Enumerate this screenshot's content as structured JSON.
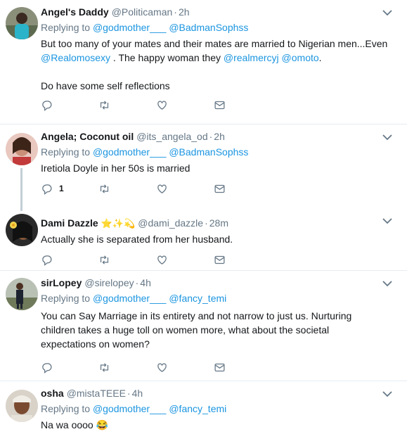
{
  "accent_color": "#1b95e0",
  "icons": {
    "reply": "reply-icon",
    "retweet": "retweet-icon",
    "like": "heart-icon",
    "dm": "mail-icon",
    "more": "chevron-down-icon"
  },
  "tweets": [
    {
      "name": "Angel's Daddy",
      "handle": "@Politicaman",
      "time": "2h",
      "reply_prefix": "Replying to",
      "reply_to": [
        "@godmother___",
        "@BadmanSophss"
      ],
      "text_line1": "But too many of your mates and their mates are married to Nigerian men...Even",
      "text_mention1": "@Realomosexy",
      "text_mid": ". The happy woman they",
      "text_mention2": "@realmercyj",
      "text_mention3": "@omoto",
      "text_end": ".",
      "text_line3": "Do have some self reflections"
    },
    {
      "name": "Angela; Coconut oil",
      "handle": "@its_angela_od",
      "time": "2h",
      "reply_prefix": "Replying to",
      "reply_to": [
        "@godmother___",
        "@BadmanSophss"
      ],
      "text": "Iretiola Doyle in her 50s is married",
      "reply_count": "1"
    },
    {
      "name": "Dami Dazzle",
      "name_emoji": "⭐✨💫",
      "handle": "@dami_dazzle",
      "time": "28m",
      "text": "Actually she is separated from her husband."
    },
    {
      "name": "sirLopey",
      "handle": "@sirelopey",
      "time": "4h",
      "reply_prefix": "Replying to",
      "reply_to": [
        "@godmother___",
        "@fancy_temi"
      ],
      "text": "You can Say Marriage in its entirety and not narrow to just us.  Nurturing children takes a huge toll on women more, what about the societal expectations on women?"
    },
    {
      "name": "osha",
      "handle": "@mistaTEEE",
      "time": "4h",
      "reply_prefix": "Replying to",
      "reply_to": [
        "@godmother___",
        "@fancy_temi"
      ],
      "text": "Na wa oooo",
      "text_emoji": "😂"
    }
  ]
}
